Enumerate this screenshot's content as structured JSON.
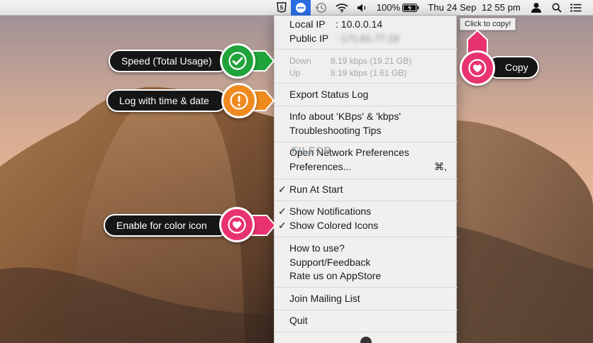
{
  "menubar": {
    "icons": [
      "html5-icon",
      "netspeed-icon",
      "time-machine-icon",
      "wifi-icon",
      "volume-icon"
    ],
    "battery_percent": "100%",
    "clock": "Thu 24 Sep  12 55 pm",
    "right_icons": [
      "user-icon",
      "spotlight-icon",
      "notification-center-icon"
    ]
  },
  "tooltip": "Click to copy!",
  "menu": {
    "local_ip_label": "Local IP",
    "local_ip_value": ": 10.0.0.14",
    "public_ip_label": "Public IP",
    "public_ip_value": ": 171.61.77.19",
    "down_label": "Down",
    "down_value": "8.19 kbps (19.21 GB)",
    "up_label": "Up",
    "up_value": "8.19 kbps (1.61 GB)",
    "export_log": "Export Status Log",
    "info_kbps": "Info about 'KBps' & 'kbps'",
    "troubleshooting": "Troubleshooting Tips",
    "open_network": "Open Network Preferences",
    "preferences": "Preferences...",
    "preferences_shortcut": "⌘,",
    "run_at_start": "Run At Start",
    "show_notifications": "Show Notifications",
    "show_colored_icons": "Show Colored Icons",
    "how_to_use": "How to use?",
    "support_feedback": "Support/Feedback",
    "rate_us": "Rate us on AppStore",
    "join_mailing": "Join Mailing List",
    "quit": "Quit",
    "check_mark": "✓"
  },
  "callouts": {
    "speed": "Speed (Total Usage)",
    "log": "Log with time & date",
    "color_icon": "Enable for color icon",
    "copy": "Copy"
  },
  "watermark": "FILECR",
  "colors": {
    "green": "#1fa33a",
    "orange": "#ef8a1f",
    "pink": "#e8336e",
    "menubar_active": "#2a6de2"
  }
}
